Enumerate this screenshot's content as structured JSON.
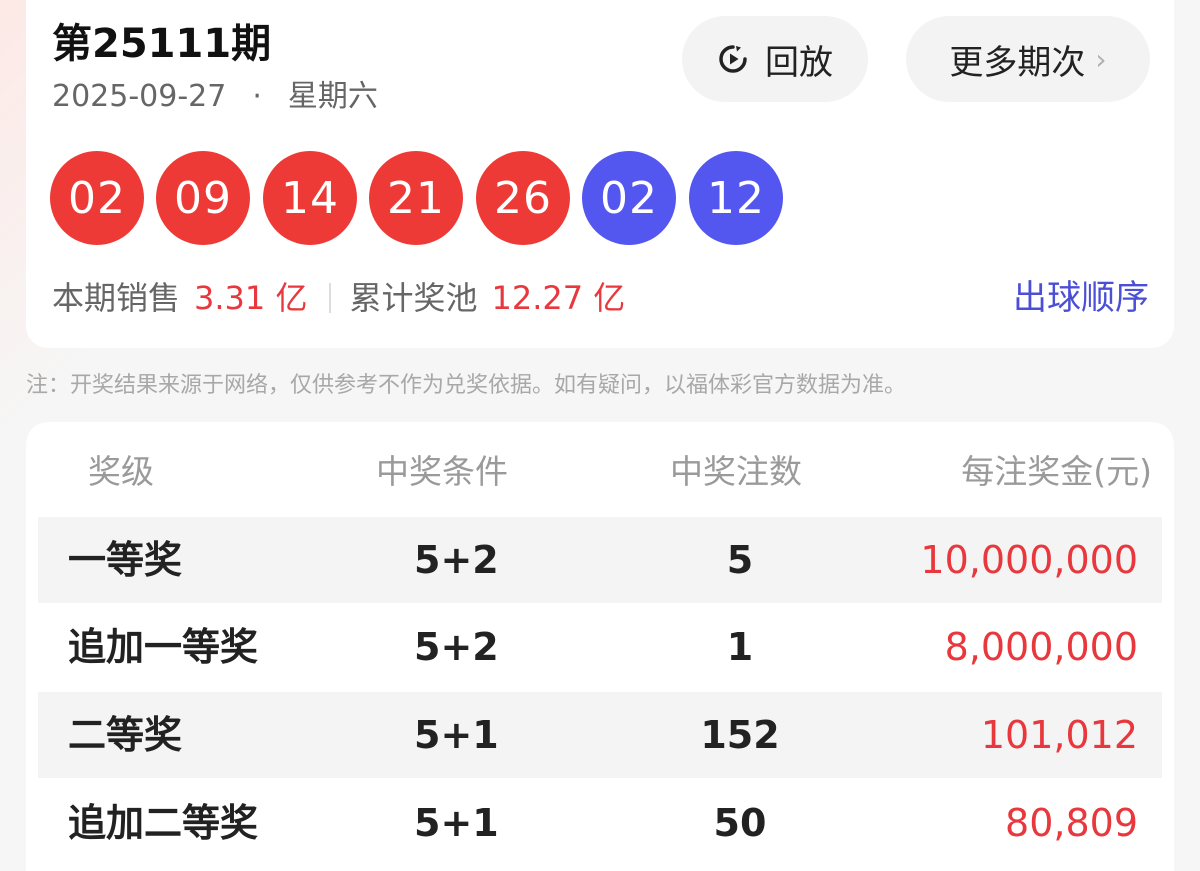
{
  "header": {
    "issue": "第25111期",
    "date": "2025-09-27",
    "separator": "·",
    "weekday": "星期六",
    "replay_label": "回放",
    "more_label": "更多期次",
    "more_chevron": "›"
  },
  "balls": {
    "front": [
      "02",
      "09",
      "14",
      "21",
      "26"
    ],
    "back": [
      "02",
      "12"
    ],
    "front_color": "#ee3a36",
    "back_color": "#5356ef"
  },
  "sales": {
    "sales_label": "本期销售",
    "sales_value": "3.31 亿",
    "pool_label": "累计奖池",
    "pool_value": "12.27 亿",
    "order_link": "出球顺序"
  },
  "note": "注：开奖结果来源于网络，仅供参考不作为兑奖依据。如有疑问，以福体彩官方数据为准。",
  "table": {
    "headers": [
      "奖级",
      "中奖条件",
      "中奖注数",
      "每注奖金(元)"
    ],
    "rows": [
      {
        "level": "一等奖",
        "condition": "5+2",
        "count": "5",
        "prize": "10,000,000"
      },
      {
        "level": "追加一等奖",
        "condition": "5+2",
        "count": "1",
        "prize": "8,000,000"
      },
      {
        "level": "二等奖",
        "condition": "5+1",
        "count": "152",
        "prize": "101,012"
      },
      {
        "level": "追加二等奖",
        "condition": "5+1",
        "count": "50",
        "prize": "80,809"
      }
    ]
  },
  "colors": {
    "accent_red": "#e8383d",
    "link_blue": "#4a4fd6"
  },
  "icons": {
    "replay": "replay-icon",
    "more": "chevron-right-icon"
  }
}
